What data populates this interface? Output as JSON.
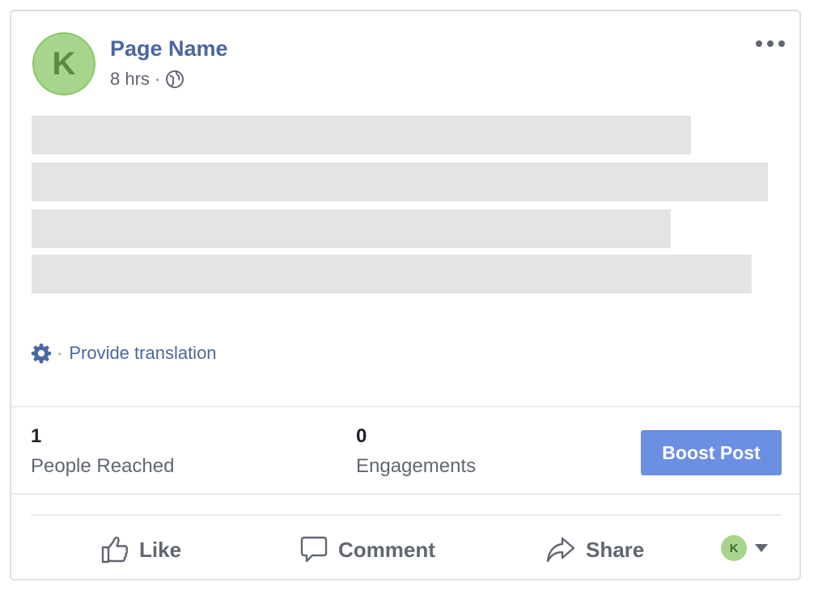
{
  "post": {
    "avatar_letter": "K",
    "page_name": "Page Name",
    "time": "8 hrs",
    "separator": "·",
    "privacy_icon": "globe-icon"
  },
  "translation": {
    "icon": "gear-icon",
    "separator": "·",
    "link": "Provide translation"
  },
  "insights": {
    "reached": {
      "value": "1",
      "label": "People Reached"
    },
    "engagements": {
      "value": "0",
      "label": "Engagements"
    },
    "boost_label": "Boost Post",
    "boost_color": "#6b8fe3"
  },
  "actions": {
    "like": "Like",
    "comment": "Comment",
    "share": "Share",
    "profile_letter": "K"
  },
  "colors": {
    "link": "#4b67a1",
    "avatar_bg": "#a8d58b",
    "placeholder": "#e4e4e4"
  }
}
